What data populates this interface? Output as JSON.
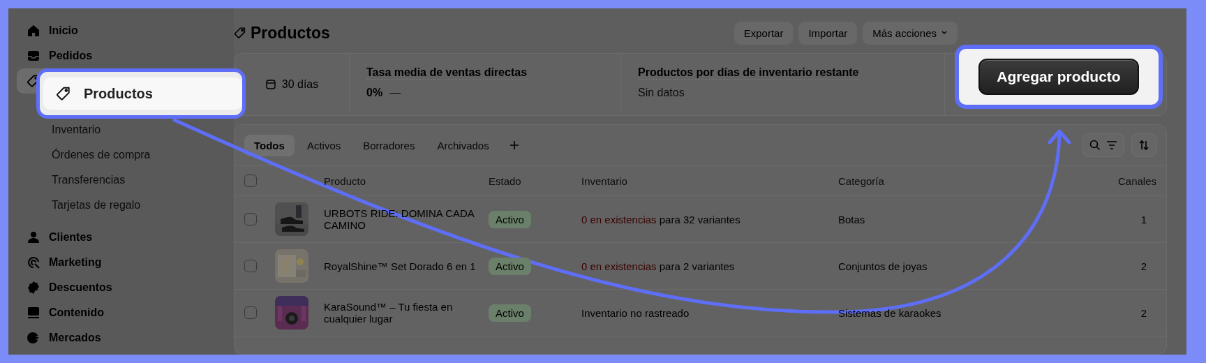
{
  "sidebar": {
    "items": [
      {
        "label": "Inicio",
        "selected": false
      },
      {
        "label": "Pedidos",
        "selected": false
      },
      {
        "selected": true,
        "children": [
          {
            "label": "Inventario",
            "selected": false
          },
          {
            "label": "Órdenes de compra",
            "selected": false
          },
          {
            "label": "Transferencias",
            "selected": false
          },
          {
            "label": "Tarjetas de regalo",
            "selected": false
          }
        ]
      },
      {
        "label": "Clientes",
        "selected": false
      },
      {
        "label": "Marketing",
        "selected": false
      },
      {
        "label": "Descuentos",
        "selected": false
      },
      {
        "label": "Contenido",
        "selected": false
      },
      {
        "label": "Mercados",
        "selected": false
      }
    ]
  },
  "header": {
    "title": "Productos",
    "actions": [
      {
        "label": "Exportar",
        "kind": "plain"
      },
      {
        "label": "Importar",
        "kind": "plain"
      },
      {
        "label": "Más acciones",
        "kind": "menu"
      }
    ]
  },
  "stats": {
    "period": "30 días",
    "metrics": [
      {
        "title": "Tasa media de ventas directas",
        "value": "0%",
        "trend": "—",
        "kind": "value"
      },
      {
        "title": "Productos por días de inventario restante",
        "value": "Sin datos",
        "kind": "empty"
      }
    ]
  },
  "tabs": [
    {
      "label": "Todos",
      "selected": true
    },
    {
      "label": "Activos",
      "selected": false
    },
    {
      "label": "Borradores",
      "selected": false
    },
    {
      "label": "Archivados",
      "selected": false
    }
  ],
  "table": {
    "all_checked": false,
    "columns": [
      "Producto",
      "Estado",
      "Inventario",
      "Categoría",
      "Canales"
    ],
    "rows": [
      {
        "checked": false,
        "product": "URBOTS RIDE: DOMINA CADA CAMINO",
        "status": "Activo",
        "inventory": {
          "alert": "0 en existencias",
          "text": "para 32 variantes"
        },
        "category": "Botas",
        "channels": "1"
      },
      {
        "checked": false,
        "product": "RoyalShine™ Set Dorado 6 en 1",
        "status": "Activo",
        "inventory": {
          "alert": "0 en existencias",
          "text": "para 2 variantes"
        },
        "category": "Conjuntos de joyas",
        "channels": "2"
      },
      {
        "checked": false,
        "product": "KaraSound™ – Tu fiesta en cualquier lugar",
        "status": "Activo",
        "inventory": {
          "text": "Inventario no rastreado"
        },
        "category": "Sistemas de karaokes",
        "channels": "2"
      }
    ]
  },
  "tutorial": {
    "sidebar_callout": "Productos",
    "button_callout": "Agregar producto"
  }
}
